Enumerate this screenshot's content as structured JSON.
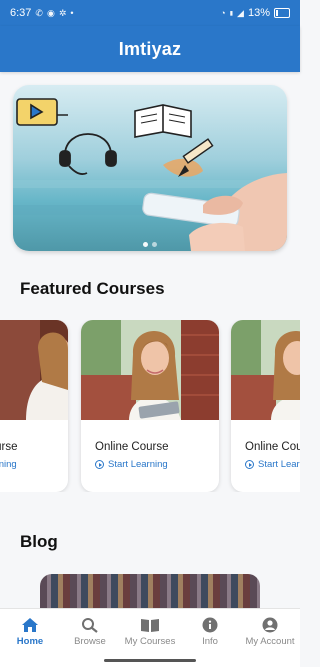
{
  "status_bar": {
    "time": "6:37",
    "battery": "13%",
    "icons": [
      "missed-call-icon",
      "whatsapp-icon",
      "settings-icon",
      "dot-icon",
      "wifi-icon",
      "volte-icon",
      "signal-icon",
      "battery-icon"
    ]
  },
  "app_bar": {
    "title": "Imtiyaz"
  },
  "banner": {
    "slides": 2,
    "active_slide": 1
  },
  "featured": {
    "heading": "Featured Courses",
    "cards": [
      {
        "title": "Online Course",
        "cta": "Start Learning"
      },
      {
        "title": "Online Course",
        "cta": "Start Learning"
      },
      {
        "title": "Online Course",
        "cta": "Start Learning"
      }
    ]
  },
  "blog": {
    "heading": "Blog"
  },
  "bottom_nav": {
    "items": [
      {
        "label": "Home",
        "icon": "home-icon",
        "active": true
      },
      {
        "label": "Browse",
        "icon": "search-icon",
        "active": false
      },
      {
        "label": "My Courses",
        "icon": "book-icon",
        "active": false
      },
      {
        "label": "Info",
        "icon": "info-icon",
        "active": false
      },
      {
        "label": "My Account",
        "icon": "account-icon",
        "active": false
      }
    ]
  },
  "colors": {
    "primary": "#2a77c9",
    "inactive": "#8a8a8a",
    "background": "#f6f7f9"
  }
}
